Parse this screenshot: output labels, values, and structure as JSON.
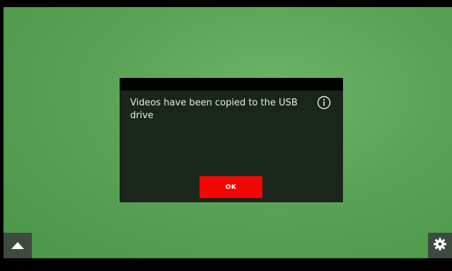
{
  "dialog": {
    "message": "Videos have been copied to the USB drive",
    "ok_label": "OK",
    "info_icon": "info-circle-icon"
  },
  "corner_buttons": {
    "left_icon": "chevron-up-icon",
    "right_icon": "gear-icon"
  },
  "colors": {
    "background_green": "#5aa356",
    "dialog_bg": "#1a2619",
    "dialog_titlebar": "#020402",
    "ok_button": "#f10606",
    "corner_button": "#3f4a3f"
  }
}
